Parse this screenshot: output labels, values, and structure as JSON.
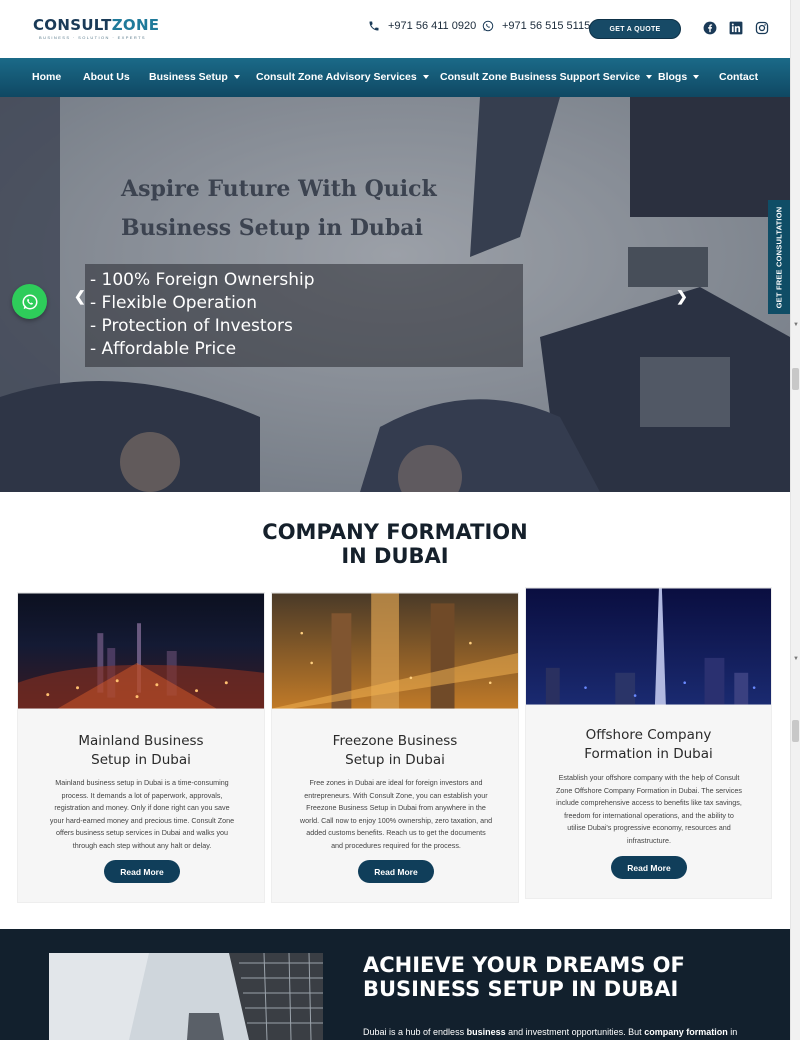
{
  "header": {
    "logo_main": "CONSULT",
    "logo_accent": "ZONE",
    "logo_tagline": "BUSINESS · SOLUTION · EXPERTS",
    "phone_1": "+971 56 411 0920",
    "phone_2": "+971 56 515 5115",
    "quote_label": "GET A QUOTE",
    "social_icons": [
      "facebook-icon",
      "linkedin-icon",
      "instagram-icon"
    ]
  },
  "nav": {
    "items": [
      {
        "label": "Home",
        "dropdown": false
      },
      {
        "label": "About Us",
        "dropdown": false
      },
      {
        "label": "Business Setup",
        "dropdown": true
      },
      {
        "label": "Consult Zone Advisory Services",
        "dropdown": true
      },
      {
        "label": "Consult Zone Business Support Service",
        "dropdown": true
      },
      {
        "label": "Blogs",
        "dropdown": true
      },
      {
        "label": "Contact",
        "dropdown": false
      }
    ]
  },
  "hero": {
    "title_line1": "Aspire Future With Quick",
    "title_line2": "Business Setup in Dubai",
    "bullets": [
      "- 100% Foreign Ownership",
      "- Flexible Operation",
      "- Protection of Investors",
      "- Affordable Price"
    ],
    "side_tab": "GET FREE CONSULTATION"
  },
  "formation": {
    "title_line1": "COMPANY FORMATION",
    "title_line2": "IN DUBAI",
    "cards": [
      {
        "title_line1": "Mainland Business",
        "title_line2": "Setup in Dubai",
        "text": [
          "Mainland business setup in Dubai is a time-consuming",
          "process. It demands a lot of paperwork, approvals,",
          "registration and money. Only if done right can you save",
          "your hard-earned money and precious time. Consult Zone",
          "offers business setup services in Dubai and walks you",
          "through each step without any halt or delay."
        ],
        "button": "Read More"
      },
      {
        "title_line1": "Freezone Business",
        "title_line2": "Setup in Dubai",
        "text": [
          "Free zones in Dubai are ideal for foreign investors and",
          "entrepreneurs. With Consult Zone, you can establish your",
          "Freezone Business Setup in Dubai from anywhere in the",
          "world. Call now to enjoy 100% ownership, zero taxation, and",
          "added customs benefits. Reach us to get the documents",
          "and procedures required for the process."
        ],
        "button": "Read More"
      },
      {
        "title_line1": "Offshore Company",
        "title_line2": "Formation in Dubai",
        "text": [
          "Establish your offshore company with the help of Consult",
          "Zone Offshore Company Formation in Dubai. The services",
          "include comprehensive access to benefits like tax savings,",
          "freedom for international operations, and the ability to",
          "utilise Dubai's progressive economy, resources and",
          "infrastructure."
        ],
        "button": "Read More"
      }
    ]
  },
  "dreams": {
    "title_line1": "ACHIEVE YOUR DREAMS OF",
    "title_line2": "BUSINESS SETUP IN DUBAI",
    "text_a": "Dubai is a hub of endless ",
    "text_b": "business",
    "text_c": " and investment opportunities. But ",
    "text_d": "company formation",
    "text_e": " in"
  },
  "colors": {
    "nav_top": "#1b6a88",
    "nav_bottom": "#0f4863",
    "button": "#103e5a",
    "dark_section": "#12202d",
    "whatsapp": "#2ecc5a"
  }
}
